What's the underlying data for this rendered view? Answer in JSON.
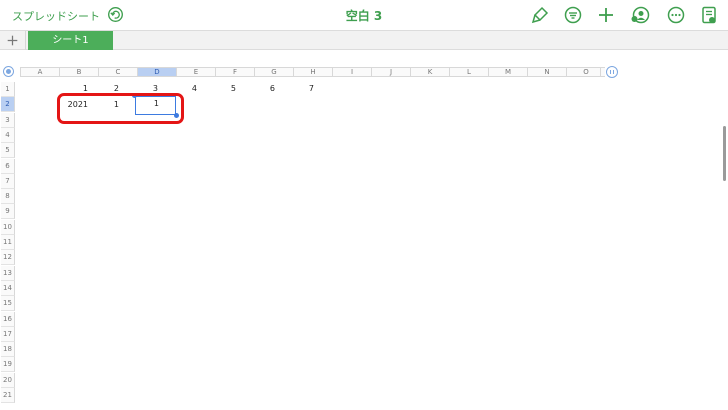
{
  "topbar": {
    "back_label": "スプレッドシート",
    "title": "空白 3",
    "icons": [
      "undo-icon",
      "format-brush-icon",
      "filter-icon",
      "add-icon",
      "collaborate-icon",
      "more-icon",
      "document-icon"
    ]
  },
  "tabs": {
    "add_icon": "plus-icon",
    "sheets": [
      "シート1"
    ],
    "active_sheet": "シート1"
  },
  "sheet": {
    "columns": [
      "A",
      "B",
      "C",
      "D",
      "E",
      "F",
      "G",
      "H",
      "I",
      "J",
      "K",
      "L",
      "M",
      "N",
      "O"
    ],
    "selected_column": "D",
    "rows": [
      "1",
      "2",
      "3",
      "4",
      "5",
      "6",
      "7",
      "8",
      "9",
      "10",
      "11",
      "12",
      "13",
      "14",
      "15",
      "16",
      "17",
      "18",
      "19",
      "20",
      "21"
    ],
    "selected_row": "2",
    "row1_values": [
      "1",
      "2",
      "3",
      "4",
      "5",
      "6",
      "7"
    ],
    "row2_values": [
      "2021",
      "1",
      "1"
    ],
    "active_cell": "D2"
  },
  "colors": {
    "accent_green": "#3f9f4f",
    "tab_green": "#4cae5a",
    "selection_blue": "#3d7be0",
    "highlight_red": "#e41515"
  }
}
